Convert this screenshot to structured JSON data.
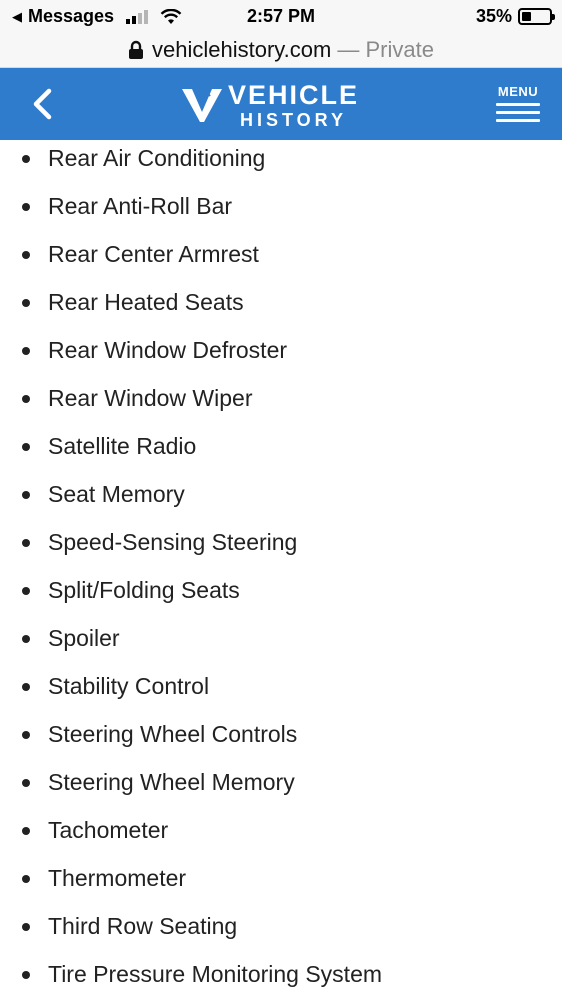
{
  "status_bar": {
    "back_app": "Messages",
    "time": "2:57 PM",
    "battery_percent_label": "35%",
    "battery_level": 0.35
  },
  "url_bar": {
    "domain": "vehiclehistory.com",
    "mode": "— Private"
  },
  "header": {
    "logo_line1": "VEHICLE",
    "logo_line2": "HISTORY",
    "menu_label": "MENU",
    "brand_color": "#2f7ccc"
  },
  "features": [
    "Rear Air Conditioning",
    "Rear Anti-Roll Bar",
    "Rear Center Armrest",
    "Rear Heated Seats",
    "Rear Window Defroster",
    "Rear Window Wiper",
    "Satellite Radio",
    "Seat Memory",
    "Speed-Sensing Steering",
    "Split/Folding Seats",
    "Spoiler",
    "Stability Control",
    "Steering Wheel Controls",
    "Steering Wheel Memory",
    "Tachometer",
    "Thermometer",
    "Third Row Seating",
    "Tire Pressure Monitoring System"
  ]
}
